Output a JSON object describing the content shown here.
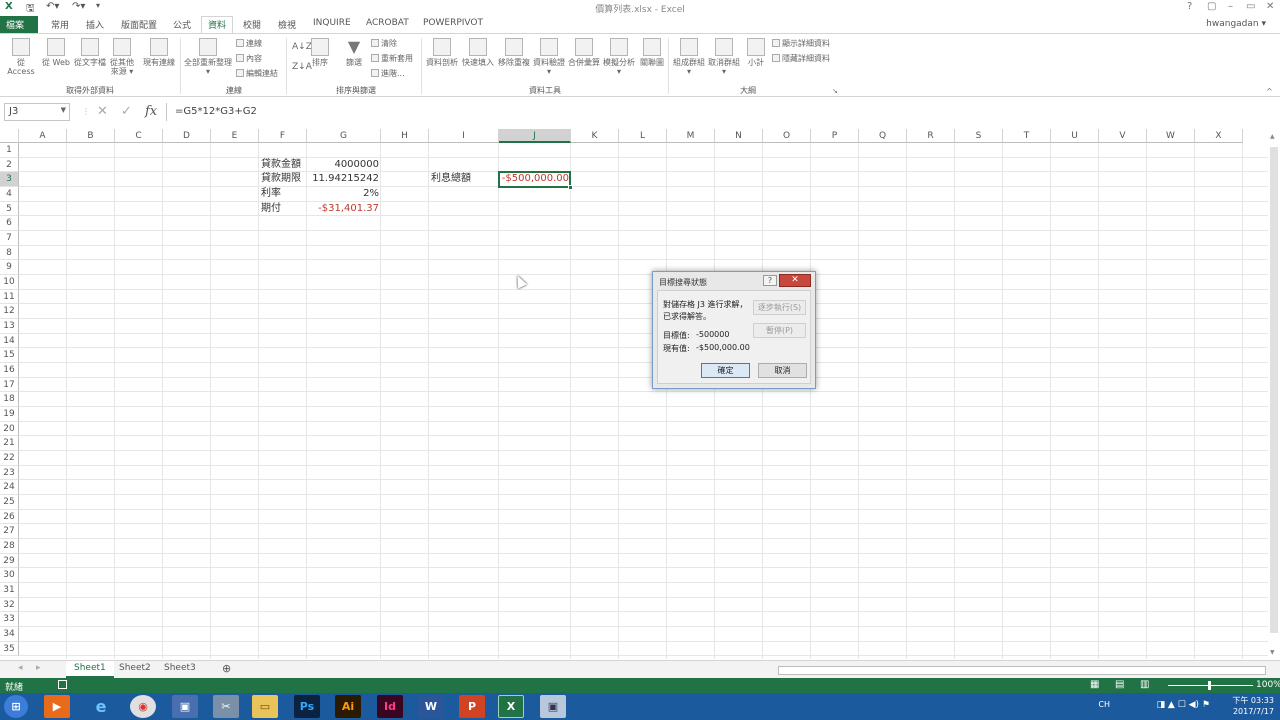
{
  "window": {
    "title": "價算列表.xlsx - Excel",
    "controls": [
      "?",
      "▢",
      "–",
      "▭",
      "✕"
    ]
  },
  "quick_access": {
    "save_icon": "save-icon",
    "undo_icon": "undo-icon",
    "redo_icon": "redo-icon"
  },
  "tabs": [
    {
      "label": "檔案",
      "type": "file"
    },
    {
      "label": "常用"
    },
    {
      "label": "插入"
    },
    {
      "label": "版面配置"
    },
    {
      "label": "公式"
    },
    {
      "label": "資料",
      "active": true
    },
    {
      "label": "校閱"
    },
    {
      "label": "檢視"
    },
    {
      "label": "INQUIRE"
    },
    {
      "label": "ACROBAT"
    },
    {
      "label": "POWERPIVOT"
    }
  ],
  "user": "hwangadan ▾",
  "ribbon": {
    "groups": {
      "external": "取得外部資料",
      "connections": "連線",
      "sort_filter": "排序與篩選",
      "data_tools": "資料工具",
      "outline": "大綱"
    },
    "buttons": {
      "from_access": "從 Access",
      "from_web": "從 Web",
      "from_text": "從文字檔",
      "from_other": "從其他",
      "from_other2": "來源 ▾",
      "existing": "現有連線",
      "refresh_all": "全部重新整理",
      "refresh_all2": "▾",
      "connections": "連線",
      "properties": "內容",
      "edit_links": "編輯連結",
      "sort": "排序",
      "filter": "篩選",
      "clear": "清除",
      "reapply": "重新套用",
      "advanced": "進階...",
      "text_to_cols": "資料剖析",
      "flash_fill": "快速填入",
      "remove_dup": "移除重複",
      "validation": "資料驗證",
      "validation2": "▾",
      "consolidate": "合併彙算",
      "what_if": "模擬分析",
      "what_if2": "▾",
      "relationships": "關聯圖",
      "group": "組成群組",
      "group2": "▾",
      "ungroup": "取消群組",
      "ungroup2": "▾",
      "subtotal": "小計",
      "show_detail": "顯示詳細資料",
      "hide_detail": "隱藏詳細資料"
    }
  },
  "formula_bar": {
    "name_box": "J3",
    "cancel": "✕",
    "enter": "✓",
    "fx": "fx",
    "formula": "=G5*12*G3+G2"
  },
  "columns": [
    "A",
    "B",
    "C",
    "D",
    "E",
    "F",
    "G",
    "H",
    "I",
    "J",
    "K",
    "L",
    "M",
    "N",
    "O",
    "P",
    "Q",
    "R",
    "S",
    "T",
    "U",
    "V",
    "W",
    "X"
  ],
  "rows": [
    "1",
    "2",
    "3",
    "4",
    "5",
    "6",
    "7",
    "8",
    "9",
    "10",
    "11",
    "12",
    "13",
    "14",
    "15",
    "16",
    "17",
    "18",
    "19",
    "20",
    "21",
    "22",
    "23",
    "24",
    "25",
    "26",
    "27",
    "28",
    "29",
    "30",
    "31",
    "32",
    "33",
    "34",
    "35"
  ],
  "cells": {
    "F2": "貸款金額",
    "G2": "4000000",
    "F3": "貸款期限",
    "G3": "11.94215242",
    "F4": "利率",
    "G4": "2%",
    "F5": "期付",
    "G5": "-$31,401.37",
    "I3": "利息總額",
    "J3": "-$500,000.00"
  },
  "sheets": [
    {
      "label": "Sheet1",
      "active": true
    },
    {
      "label": "Sheet2"
    },
    {
      "label": "Sheet3"
    }
  ],
  "add_sheet": "⊕",
  "status": {
    "ready": "就緒",
    "zoom": "100%"
  },
  "dialog": {
    "title": "目標搜尋狀態",
    "help": "?",
    "close": "✕",
    "msg1": "對儲存格 J3 進行求解，",
    "msg2": "已求得解答。",
    "target_label": "目標值:",
    "target_value": "-500000",
    "current_label": "現有值:",
    "current_value": "-$500,000.00",
    "step_button": "逐步執行(S)",
    "pause_button": "暫停(P)",
    "ok_button": "確定",
    "cancel_button": "取消"
  },
  "taskbar": {
    "apps": [
      "Ps",
      "Ai",
      "Id",
      "W",
      "P",
      "X"
    ],
    "tray_lang": "CH",
    "time": "下午 03:33",
    "date": "2017/7/17"
  }
}
